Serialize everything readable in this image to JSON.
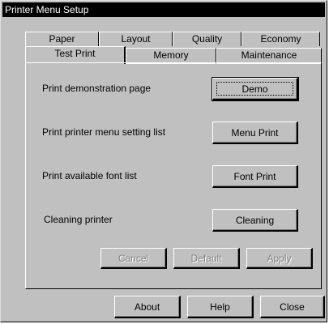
{
  "window": {
    "title": "Printer Menu Setup"
  },
  "tabs_back": [
    {
      "label": "Paper"
    },
    {
      "label": "Layout"
    },
    {
      "label": "Quality"
    },
    {
      "label": "Economy"
    }
  ],
  "tabs_front": [
    {
      "label": "Test Print",
      "active": true
    },
    {
      "label": "Memory"
    },
    {
      "label": "Maintenance"
    }
  ],
  "panel": {
    "rows": [
      {
        "label": "Print demonstration page",
        "button": "Demo"
      },
      {
        "label": "Print printer menu setting list",
        "button": "Menu Print"
      },
      {
        "label": "Print available font list",
        "button": "Font Print"
      },
      {
        "label": "Cleaning printer",
        "button": "Cleaning"
      }
    ],
    "actions": {
      "cancel": "Cancel",
      "default": "Default",
      "apply": "Apply"
    }
  },
  "footer": {
    "about": "About",
    "help": "Help",
    "close": "Close"
  }
}
